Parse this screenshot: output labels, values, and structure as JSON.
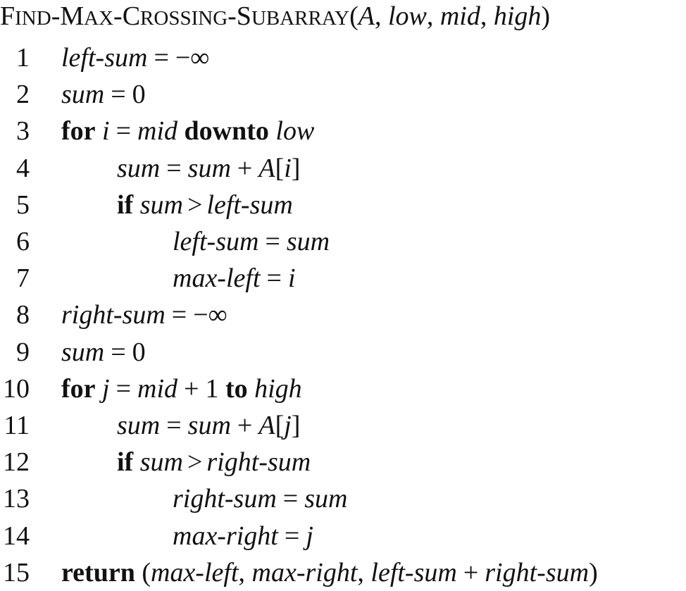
{
  "procedure": {
    "name_parts": [
      {
        "big": "F",
        "small": "IND"
      },
      {
        "sep": "-"
      },
      {
        "big": "M",
        "small": "AX"
      },
      {
        "sep": "-"
      },
      {
        "big": "C",
        "small": "ROSSING"
      },
      {
        "sep": "-"
      },
      {
        "big": "S",
        "small": "UBARRAY"
      }
    ],
    "open_paren": "(",
    "params": [
      "A",
      "low",
      "mid",
      "high"
    ],
    "comma": ",",
    "close_paren": ")"
  },
  "lines": [
    {
      "num": "1",
      "indent": 0,
      "tokens": [
        {
          "t": "left-sum",
          "s": "i"
        },
        {
          "t": "=",
          "s": "op"
        },
        {
          "t": "−∞",
          "s": "n"
        }
      ]
    },
    {
      "num": "2",
      "indent": 0,
      "tokens": [
        {
          "t": "sum",
          "s": "i"
        },
        {
          "t": "=",
          "s": "op"
        },
        {
          "t": "0",
          "s": "n"
        }
      ]
    },
    {
      "num": "3",
      "indent": 0,
      "tokens": [
        {
          "t": "for",
          "s": "b"
        },
        {
          "t": " ",
          "s": "n"
        },
        {
          "t": "i",
          "s": "i"
        },
        {
          "t": "=",
          "s": "op"
        },
        {
          "t": "mid",
          "s": "i"
        },
        {
          "t": " ",
          "s": "n"
        },
        {
          "t": "downto",
          "s": "b"
        },
        {
          "t": " ",
          "s": "n"
        },
        {
          "t": "low",
          "s": "i"
        }
      ]
    },
    {
      "num": "4",
      "indent": 1,
      "tokens": [
        {
          "t": "sum",
          "s": "i"
        },
        {
          "t": "=",
          "s": "op"
        },
        {
          "t": "sum",
          "s": "i"
        },
        {
          "t": "+",
          "s": "op"
        },
        {
          "t": "A",
          "s": "i"
        },
        {
          "t": "[",
          "s": "n"
        },
        {
          "t": "i",
          "s": "i"
        },
        {
          "t": "]",
          "s": "n"
        }
      ]
    },
    {
      "num": "5",
      "indent": 1,
      "tokens": [
        {
          "t": "if",
          "s": "b"
        },
        {
          "t": " ",
          "s": "n"
        },
        {
          "t": "sum",
          "s": "i"
        },
        {
          "t": ">",
          "s": "sp"
        },
        {
          "t": "left-sum",
          "s": "i"
        }
      ]
    },
    {
      "num": "6",
      "indent": 2,
      "tokens": [
        {
          "t": "left-sum",
          "s": "i"
        },
        {
          "t": "=",
          "s": "op"
        },
        {
          "t": "sum",
          "s": "i"
        }
      ]
    },
    {
      "num": "7",
      "indent": 2,
      "tokens": [
        {
          "t": "max-left",
          "s": "i"
        },
        {
          "t": "=",
          "s": "op"
        },
        {
          "t": "i",
          "s": "i"
        }
      ]
    },
    {
      "num": "8",
      "indent": 0,
      "tokens": [
        {
          "t": "right-sum",
          "s": "i"
        },
        {
          "t": "=",
          "s": "op"
        },
        {
          "t": "−∞",
          "s": "n"
        }
      ]
    },
    {
      "num": "9",
      "indent": 0,
      "tokens": [
        {
          "t": "sum",
          "s": "i"
        },
        {
          "t": "=",
          "s": "op"
        },
        {
          "t": "0",
          "s": "n"
        }
      ]
    },
    {
      "num": "10",
      "indent": 0,
      "tokens": [
        {
          "t": "for",
          "s": "b"
        },
        {
          "t": " ",
          "s": "n"
        },
        {
          "t": "j",
          "s": "i"
        },
        {
          "t": "=",
          "s": "op"
        },
        {
          "t": "mid",
          "s": "i"
        },
        {
          "t": "+",
          "s": "op"
        },
        {
          "t": "1",
          "s": "n"
        },
        {
          "t": " ",
          "s": "n"
        },
        {
          "t": "to",
          "s": "b"
        },
        {
          "t": " ",
          "s": "n"
        },
        {
          "t": "high",
          "s": "i"
        }
      ]
    },
    {
      "num": "11",
      "indent": 1,
      "tokens": [
        {
          "t": "sum",
          "s": "i"
        },
        {
          "t": "=",
          "s": "op"
        },
        {
          "t": "sum",
          "s": "i"
        },
        {
          "t": "+",
          "s": "op"
        },
        {
          "t": "A",
          "s": "i"
        },
        {
          "t": "[",
          "s": "n"
        },
        {
          "t": "j",
          "s": "i"
        },
        {
          "t": "]",
          "s": "n"
        }
      ]
    },
    {
      "num": "12",
      "indent": 1,
      "tokens": [
        {
          "t": "if",
          "s": "b"
        },
        {
          "t": " ",
          "s": "n"
        },
        {
          "t": "sum",
          "s": "i"
        },
        {
          "t": ">",
          "s": "sp"
        },
        {
          "t": "right-sum",
          "s": "i"
        }
      ]
    },
    {
      "num": "13",
      "indent": 2,
      "tokens": [
        {
          "t": "right-sum",
          "s": "i"
        },
        {
          "t": "=",
          "s": "op"
        },
        {
          "t": "sum",
          "s": "i"
        }
      ]
    },
    {
      "num": "14",
      "indent": 2,
      "tokens": [
        {
          "t": "max-right",
          "s": "i"
        },
        {
          "t": "=",
          "s": "op"
        },
        {
          "t": "j",
          "s": "i"
        }
      ]
    },
    {
      "num": "15",
      "indent": 0,
      "tokens": [
        {
          "t": "return",
          "s": "b"
        },
        {
          "t": " (",
          "s": "n"
        },
        {
          "t": "max-left",
          "s": "i"
        },
        {
          "t": ", ",
          "s": "n"
        },
        {
          "t": "max-right",
          "s": "i"
        },
        {
          "t": ", ",
          "s": "n"
        },
        {
          "t": "left-sum",
          "s": "i"
        },
        {
          "t": "+",
          "s": "op"
        },
        {
          "t": "right-sum",
          "s": "i"
        },
        {
          "t": ")",
          "s": "n"
        }
      ]
    }
  ]
}
